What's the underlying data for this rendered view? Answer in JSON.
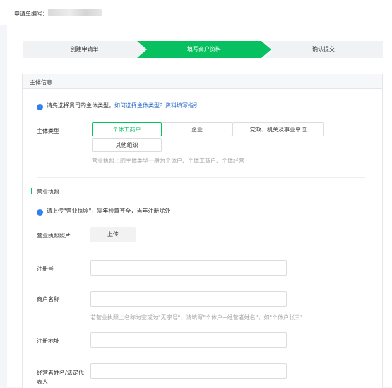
{
  "header": {
    "application_no_label": "申请单编号："
  },
  "steps": [
    {
      "label": "创建申请单"
    },
    {
      "label": "填写商户资料"
    },
    {
      "label": "确认提交"
    }
  ],
  "colors": {
    "accent": "#07c160",
    "link": "#2a68c9",
    "info": "#2f7ff0"
  },
  "subject_section": {
    "title": "主体信息",
    "notice_text": "请先选择贵司的主体类型。",
    "notice_link": "如何选择主体类型？资料填写指引",
    "type_label": "主体类型",
    "options": [
      "个体工商户",
      "企业",
      "党政、机关及事业单位",
      "其他组织"
    ],
    "selected_option": "个体工商户",
    "hint": "营业执照上的主体类型一般为个体户、个体工商户、个体经营"
  },
  "license_section": {
    "title": "营业执照",
    "notice": "请上传\"营业执照\"，需年检章齐全，当年注册除外",
    "photo_label": "营业执照照片",
    "upload_button": "上传",
    "reg_no_label": "注册号",
    "merchant_name_label": "商户名称",
    "merchant_name_hint": "若营业执照上名称为空或为\"无字号\"，请填写\"个体户+经营者姓名\"，如\"个体户张三\"",
    "reg_address_label": "注册地址",
    "legal_rep_label_line1": "经营者姓名/法定代",
    "legal_rep_label_line2": "表人"
  }
}
